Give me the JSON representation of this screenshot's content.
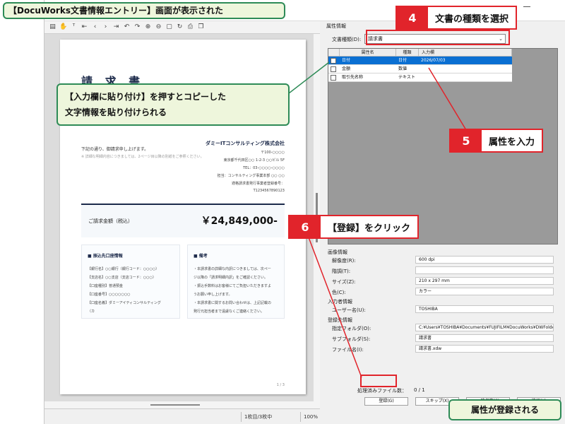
{
  "caption_top": "【DocuWorks文書情報エントリー】画面が表示された",
  "callout_paste": {
    "line1": "【入力欄に貼り付け】を押すとコピーした",
    "line2": "文字情報を貼り付けられる"
  },
  "callout_done": "属性が登録される",
  "steps": {
    "s4": {
      "num": "4",
      "text": "文書の種類を選択"
    },
    "s5": {
      "num": "5",
      "text": "属性を入力"
    },
    "s6": {
      "num": "6",
      "text": "【登録】をクリック"
    }
  },
  "accent_red": "#e1242b",
  "accent_green": "#2e8b57",
  "selection_blue": "#0a6fd2",
  "toolbar_icons": [
    "page-icon",
    "hand-icon",
    "text-cursor-icon",
    "first-page-icon",
    "prev-page-icon",
    "next-page-icon",
    "last-page-icon",
    "back-icon",
    "forward-icon",
    "zoom-in-icon",
    "zoom-out-icon",
    "fit-page-icon",
    "rotate-icon",
    "print-icon",
    "copy-icon"
  ],
  "document": {
    "title": "請 求 書",
    "greeting": "下記の通り、御請求申し上げます。",
    "note": "※ 詳細な明細内容につきましては、2ページ目以降の別紙をご参照ください。",
    "company": "ダミーITコンサルティング株式会社",
    "address": [
      "〒100-○○○○",
      "東京都千代田区○○ 1-2-3 ○○ビル 5F",
      "TEL：03-○○○○-○○○○",
      "担当：コンサルティング事業本部 ○○ ○○",
      "適格請求書発行事業者登録番号：",
      "T1234567890123"
    ],
    "amount_label": "ご請求金額（税込）",
    "amount_value": "￥24,849,000-",
    "bank": {
      "title": "■ 振込先口座情報",
      "lines": [
        "【銀行名】○○銀行（銀行コード：○○○○）",
        "【支店名】○○支店（支店コード：○○○）",
        "【口座種別】普通預金",
        "【口座番号】○○○○○○○",
        "【口座名義】ダミーアイティコンサルティング",
        "（カ"
      ]
    },
    "remarks": {
      "title": "■ 備考",
      "lines": [
        "・本請求書の詳細な内訳につきましては、次ペー",
        "ジ以降の「請求明細内訳」をご確認ください。",
        "・振込手数料はお客様にてご負担いただきますよ",
        "うお願い申し上げます。",
        "・本請求書に関するお問い合わせは、上記記載の",
        "発行元担当者まで遠慮なくご連絡ください。"
      ]
    },
    "page_number": "1 / 3"
  },
  "statusbar": {
    "page": "1枚目/3枚中",
    "zoom": "100%"
  },
  "panel": {
    "tab": "属性情報",
    "doctype_label": "文書種類(D):",
    "doctype_value": "請求書",
    "columns": [
      "属性名",
      "種類",
      "入力欄"
    ],
    "rows": [
      {
        "name": "日付",
        "type": "日付",
        "value": "2026/07/03"
      },
      {
        "name": "金額",
        "type": "数値",
        "value": ""
      },
      {
        "name": "取引先名称",
        "type": "テキスト",
        "value": ""
      }
    ],
    "image_info": {
      "title": "画像情報",
      "resolution_label": "解像度(R):",
      "resolution_value": "600 dpi",
      "gradation_label": "階調(T):",
      "gradation_value": "",
      "size_label": "サイズ(Z):",
      "size_value": "210 x 297 mm",
      "color_label": "色(C):",
      "color_value": "カラー"
    },
    "user_info": {
      "title": "入力者情報",
      "user_label": "ユーザー名(U):",
      "user_value": "TOSHIBA"
    },
    "dest_info": {
      "title": "登録先情報",
      "folder_label": "指定フォルダ(O):",
      "folder_value": "C:¥Users¥TOSHIBA¥Documents¥FUJIFILM¥DocuWorks¥DWFolde",
      "subfolder_label": "サブフォルダ(S):",
      "subfolder_value": "請求書",
      "filename_label": "ファイル名(I):",
      "filename_value": "請求書.xdw"
    },
    "processed_label": "処理済みファイル数：",
    "processed_value": "0 / 1",
    "buttons": {
      "register": "登録(G)",
      "skip": "スキップ(X)",
      "save": "一時保存(S)",
      "finish": "終了(X)"
    }
  }
}
